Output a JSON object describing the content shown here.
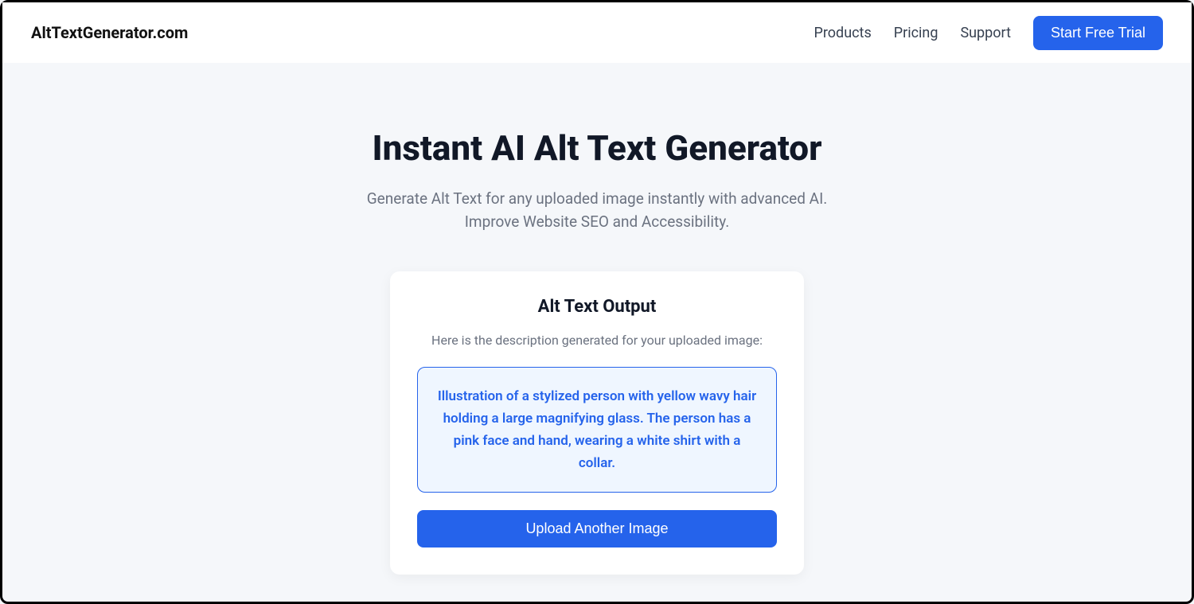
{
  "header": {
    "logo": "AltTextGenerator.com",
    "nav": {
      "products": "Products",
      "pricing": "Pricing",
      "support": "Support"
    },
    "cta": "Start Free Trial"
  },
  "hero": {
    "title": "Instant AI Alt Text Generator",
    "subtitle": "Generate Alt Text for any uploaded image instantly with advanced AI. Improve Website SEO and Accessibility."
  },
  "card": {
    "title": "Alt Text Output",
    "subtitle": "Here is the description generated for your uploaded image:",
    "output": "Illustration of a stylized person with yellow wavy hair holding a large magnifying glass. The person has a pink face and hand, wearing a white shirt with a collar.",
    "upload_button": "Upload Another Image"
  }
}
